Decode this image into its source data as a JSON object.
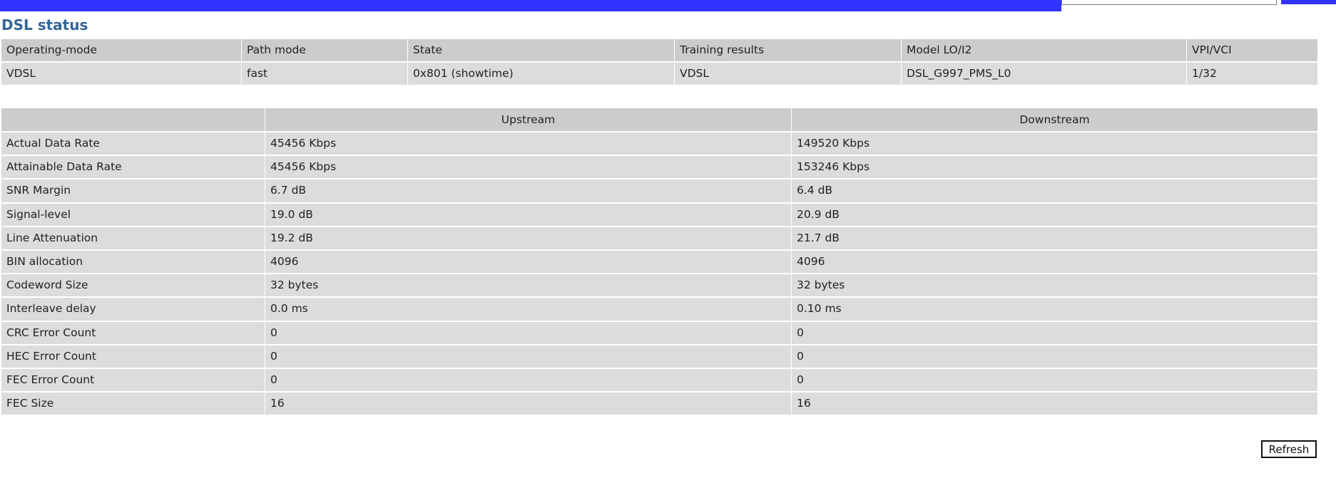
{
  "title": "DSL status",
  "status": {
    "headers": [
      "Operating-mode",
      "Path mode",
      "State",
      "Training results",
      "Model LO/I2",
      "VPI/VCI"
    ],
    "values": [
      "VDSL",
      "fast",
      "0x801 (showtime)",
      "VDSL",
      "DSL_G997_PMS_L0",
      "1/32"
    ]
  },
  "stats": {
    "headers": [
      "",
      "Upstream",
      "Downstream"
    ],
    "rows": [
      {
        "label": "Actual Data Rate",
        "upstream": "45456 Kbps",
        "downstream": "149520 Kbps"
      },
      {
        "label": "Attainable Data Rate",
        "upstream": "45456 Kbps",
        "downstream": "153246 Kbps"
      },
      {
        "label": "SNR Margin",
        "upstream": "6.7 dB",
        "downstream": "6.4 dB"
      },
      {
        "label": "Signal-level",
        "upstream": "19.0 dB",
        "downstream": "20.9 dB"
      },
      {
        "label": "Line Attenuation",
        "upstream": "19.2 dB",
        "downstream": "21.7 dB"
      },
      {
        "label": "BIN allocation",
        "upstream": "4096",
        "downstream": "4096"
      },
      {
        "label": "Codeword Size",
        "upstream": "32 bytes",
        "downstream": "32 bytes"
      },
      {
        "label": "Interleave delay",
        "upstream": "0.0 ms",
        "downstream": "0.10 ms"
      },
      {
        "label": "CRC Error Count",
        "upstream": "0",
        "downstream": "0"
      },
      {
        "label": "HEC Error Count",
        "upstream": "0",
        "downstream": "0"
      },
      {
        "label": "FEC Error Count",
        "upstream": "0",
        "downstream": "0"
      },
      {
        "label": "FEC Size",
        "upstream": "16",
        "downstream": "16"
      }
    ]
  },
  "refresh_label": "Refresh",
  "colors": {
    "topbar": "#3333ff",
    "title": "#336699",
    "header_bg": "#cbcdcd",
    "cell_bg": "#dcdcdc"
  }
}
